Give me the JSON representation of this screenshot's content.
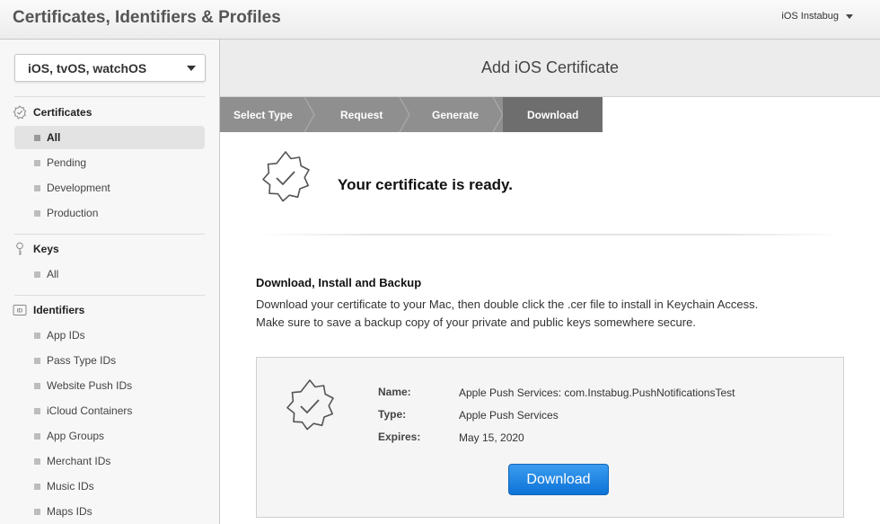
{
  "topbar": {
    "title": "Certificates, Identifiers & Profiles",
    "account": "iOS Instabug"
  },
  "sidebar": {
    "platform": "iOS, tvOS, watchOS",
    "certificates": {
      "heading": "Certificates",
      "items": [
        "All",
        "Pending",
        "Development",
        "Production"
      ]
    },
    "keys": {
      "heading": "Keys",
      "items": [
        "All"
      ]
    },
    "identifiers": {
      "heading": "Identifiers",
      "items": [
        "App IDs",
        "Pass Type IDs",
        "Website Push IDs",
        "iCloud Containers",
        "App Groups",
        "Merchant IDs",
        "Music IDs",
        "Maps IDs"
      ]
    }
  },
  "main": {
    "title": "Add iOS Certificate",
    "steps": [
      "Select Type",
      "Request",
      "Generate",
      "Download"
    ],
    "ready_message": "Your certificate is ready.",
    "download_heading": "Download, Install and Backup",
    "download_desc_1": "Download your certificate to your Mac, then double click the .cer file to install in Keychain Access.",
    "download_desc_2": "Make sure to save a backup copy of your private and public keys somewhere secure.",
    "certificate": {
      "name_label": "Name:",
      "name": "Apple Push Services: com.Instabug.PushNotificationsTest",
      "type_label": "Type:",
      "type": "Apple Push Services",
      "expires_label": "Expires:",
      "expires": "May 15, 2020",
      "download_label": "Download"
    }
  },
  "colors": {
    "accent": "#0d73d6",
    "step_bar": "#8f8f8f",
    "step_active": "#6e6e6e"
  }
}
